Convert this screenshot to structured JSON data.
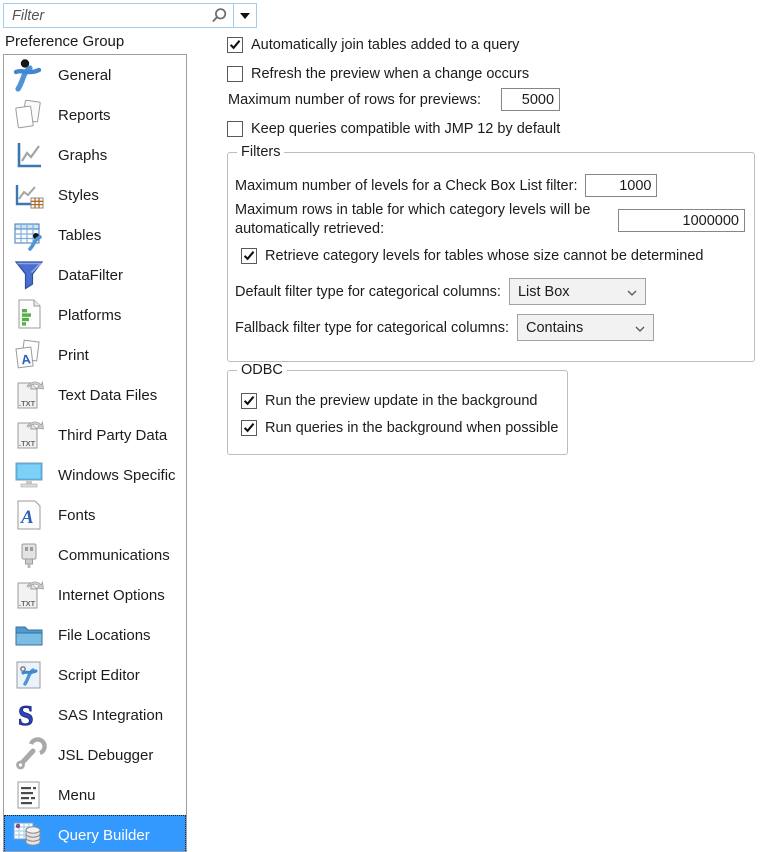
{
  "filter_box": {
    "placeholder": "Filter",
    "search_icon": "magnifier-icon",
    "dropdown_icon": "dropdown-arrow-icon"
  },
  "sidebar": {
    "title": "Preference Group",
    "selected_item": "Query Builder",
    "items": [
      {
        "label": "General",
        "icon": "general-icon",
        "selected": false
      },
      {
        "label": "Reports",
        "icon": "reports-icon",
        "selected": false
      },
      {
        "label": "Graphs",
        "icon": "graphs-icon",
        "selected": false
      },
      {
        "label": "Styles",
        "icon": "styles-icon",
        "selected": false
      },
      {
        "label": "Tables",
        "icon": "tables-icon",
        "selected": false
      },
      {
        "label": "DataFilter",
        "icon": "data-filter-icon",
        "selected": false
      },
      {
        "label": "Platforms",
        "icon": "platforms-icon",
        "selected": false
      },
      {
        "label": "Print",
        "icon": "print-icon",
        "selected": false
      },
      {
        "label": "Text Data Files",
        "icon": "text-data-files-icon",
        "selected": false
      },
      {
        "label": "Third Party Data",
        "icon": "third-party-data-icon",
        "selected": false
      },
      {
        "label": "Windows Specific",
        "icon": "windows-specific-icon",
        "selected": false
      },
      {
        "label": "Fonts",
        "icon": "fonts-icon",
        "selected": false
      },
      {
        "label": "Communications",
        "icon": "communications-icon",
        "selected": false
      },
      {
        "label": "Internet Options",
        "icon": "internet-options-icon",
        "selected": false
      },
      {
        "label": "File Locations",
        "icon": "file-locations-icon",
        "selected": false
      },
      {
        "label": "Script Editor",
        "icon": "script-editor-icon",
        "selected": false
      },
      {
        "label": "SAS Integration",
        "icon": "sas-integration-icon",
        "selected": false
      },
      {
        "label": "JSL Debugger",
        "icon": "jsl-debugger-icon",
        "selected": false
      },
      {
        "label": "Menu",
        "icon": "menu-icon",
        "selected": false
      },
      {
        "label": "Query Builder",
        "icon": "query-builder-icon",
        "selected": true
      }
    ]
  },
  "main": {
    "auto_join": {
      "label": "Automatically join tables added to a query",
      "checked": true
    },
    "refresh_preview": {
      "label": "Refresh the preview when a change occurs",
      "checked": false
    },
    "max_rows_previews": {
      "label": "Maximum number of rows for previews:",
      "value": "5000"
    },
    "jmp12_compat": {
      "label": "Keep queries compatible with JMP 12 by default",
      "checked": false
    },
    "filters_group": {
      "title": "Filters",
      "max_levels_checkbox_list": {
        "label": "Maximum number of levels for a Check Box List filter:",
        "value": "1000"
      },
      "max_rows_category": {
        "label": "Maximum rows in table for which category levels will be automatically retrieved:",
        "value": "1000000"
      },
      "retrieve_category_levels": {
        "label": "Retrieve category levels for tables whose size cannot be determined",
        "checked": true
      },
      "default_filter_type": {
        "label": "Default filter type for categorical columns:",
        "value": "List Box"
      },
      "fallback_filter_type": {
        "label": "Fallback filter type for categorical columns:",
        "value": "Contains"
      }
    },
    "odbc_group": {
      "title": "ODBC",
      "run_preview_background": {
        "label": "Run the preview update in the background",
        "checked": true
      },
      "run_queries_background": {
        "label": "Run queries in the background when possible",
        "checked": true
      }
    }
  },
  "colors": {
    "selection_blue": "#3399FF",
    "filter_box_border": "#A6CCE8",
    "group_border": "#BDBDBD",
    "list_border": "#9F9F9F"
  }
}
